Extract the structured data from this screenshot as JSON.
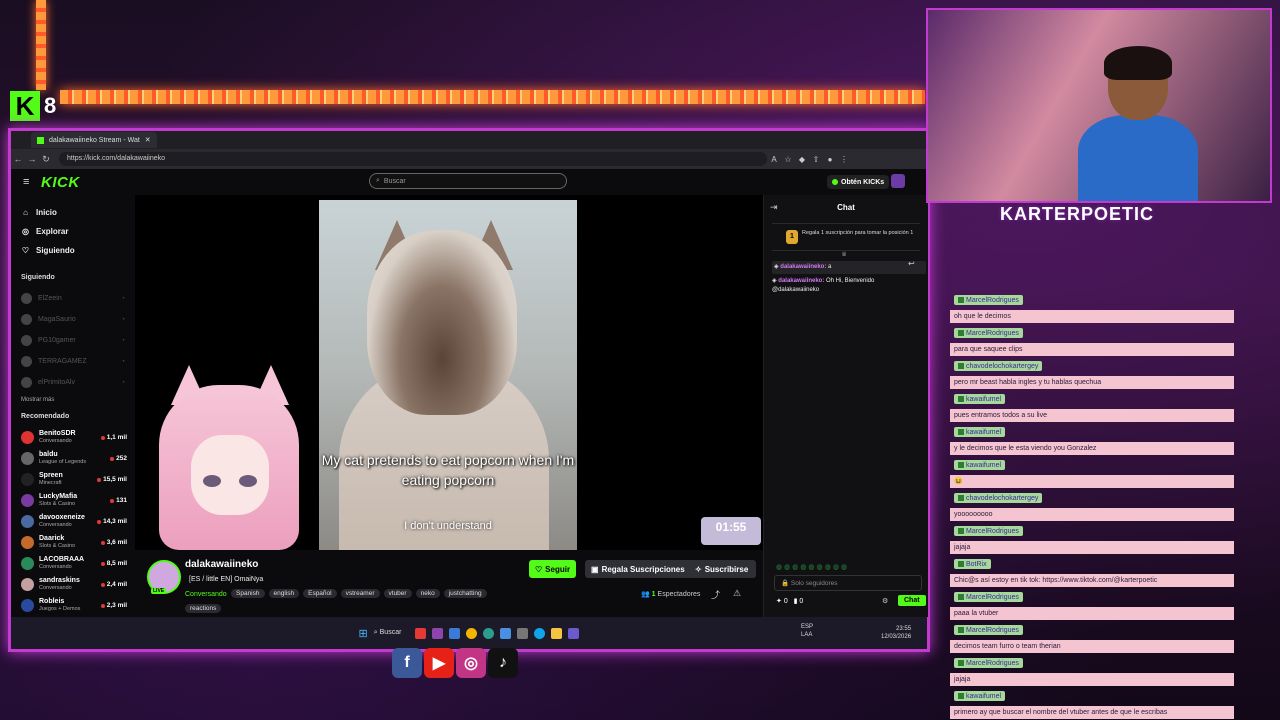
{
  "overlay_badge": {
    "kick_letter": "K",
    "count": "8"
  },
  "browser": {
    "tab_title": "dalakawaiineko Stream - Wat",
    "url": "https://kick.com/dalakawaiineko"
  },
  "kick": {
    "logo": "KICK",
    "search_placeholder": "Buscar",
    "get_kicks": "Obtén KICKs"
  },
  "sidebar": {
    "nav": [
      {
        "label": "Inicio",
        "icon": "home-icon"
      },
      {
        "label": "Explorar",
        "icon": "compass-icon"
      },
      {
        "label": "Siguiendo",
        "icon": "heart-icon"
      }
    ],
    "following_heading": "Siguiendo",
    "following": [
      "ElZeein",
      "MagaSaurio",
      "PG10gamer",
      "TERRAGAMEZ",
      "elPrimitoAlv"
    ],
    "show_more": "Mostrar más",
    "recommended_heading": "Recomendado",
    "recommended": [
      {
        "name": "BenitoSDR",
        "category": "Conversando",
        "viewers": "1,1 mil",
        "color": "#d33"
      },
      {
        "name": "baldu",
        "category": "League of Legends",
        "viewers": "252",
        "color": "#666"
      },
      {
        "name": "Spreen",
        "category": "Minecraft",
        "viewers": "15,5 mil",
        "color": "#222"
      },
      {
        "name": "LuckyMafia",
        "category": "Slots & Casino",
        "viewers": "131",
        "color": "#7a3aa0"
      },
      {
        "name": "davooxeneize",
        "category": "Conversando",
        "viewers": "14,3 mil",
        "color": "#4a6aa0"
      },
      {
        "name": "Daarick",
        "category": "Slots & Casino",
        "viewers": "3,6 mil",
        "color": "#c46a2a"
      },
      {
        "name": "LACOBRAAA",
        "category": "Conversando",
        "viewers": "8,5 mil",
        "color": "#2a8a5a"
      },
      {
        "name": "sandraskins",
        "category": "Conversando",
        "viewers": "2,4 mil",
        "color": "#c4a0a0"
      },
      {
        "name": "Robleis",
        "category": "Juegos + Demos",
        "viewers": "2,3 mil",
        "color": "#2a4aa0"
      }
    ]
  },
  "video": {
    "caption": "My cat pretends to eat popcorn when I'm eating popcorn",
    "subcaption": "I don't understand",
    "timer": "01:55"
  },
  "stream": {
    "live_label": "LIVE",
    "name": "dalakawaiineko",
    "title": "[ES / little EN] OmaiNya",
    "category": "Conversando",
    "tags": [
      "Spanish",
      "english",
      "Español",
      "vstreamer",
      "vtuber",
      "neko",
      "justchatting"
    ],
    "tag_second_row": "reactions",
    "follow": "Seguir",
    "gift": "Regala Suscripciones",
    "subscribe": "Suscribirse",
    "viewers_count": "1",
    "viewers_label": "Espectadores"
  },
  "chat": {
    "title": "Chat",
    "gift_coin": "1",
    "gift_banner": "Regala 1 suscripción para tomar la posición 1",
    "messages": [
      {
        "user": "dalakawaiineko:",
        "text": "a"
      },
      {
        "user": "dalakawaiineko:",
        "text": "Oh Hi, Bienvenido @dalakawaiineko"
      }
    ],
    "emotes": "◍◍◍◍◍◍◍◍◍",
    "input_placeholder": "Solo seguidores",
    "footer_left": "0",
    "footer_mid": "0",
    "send": "Chat"
  },
  "taskbar": {
    "search": "Buscar",
    "lang": "ESP",
    "region": "LAA",
    "time": "23:55",
    "date": "12/03/2026"
  },
  "streamer_name": "KARTERPOETIC",
  "overlay_chat": [
    {
      "user": "MarcelRodrigues",
      "text": "oh que le decimos"
    },
    {
      "user": "MarcelRodrigues",
      "text": "para que saquee clips"
    },
    {
      "user": "chavodelochokartergey",
      "text": "pero mr beast habla ingles y tu hablas quechua"
    },
    {
      "user": "kawaifumel",
      "text": "pues entramos todos a su live"
    },
    {
      "user": "kawaifumel",
      "text": "y le decimos que le esta viendo you Gonzalez"
    },
    {
      "user": "kawaifumel",
      "text": "😆"
    },
    {
      "user": "chavodelochokartergey",
      "text": "yooooooooo"
    },
    {
      "user": "MarcelRodrigues",
      "text": "jajaja"
    },
    {
      "user": "BotRix",
      "text": "Chic@s así estoy en tik tok: https://www.tiktok.com/@karterpoetic"
    },
    {
      "user": "MarcelRodrigues",
      "text": "paaa la vtuber"
    },
    {
      "user": "MarcelRodrigues",
      "text": "decimos team furro o team therian"
    },
    {
      "user": "MarcelRodrigues",
      "text": "jajaja"
    },
    {
      "user": "kawaifumel",
      "text": "primero ay que buscar el nombre del vtuber antes de que le escribas"
    }
  ],
  "socials": [
    "f",
    "▶",
    "◎",
    "♪"
  ]
}
